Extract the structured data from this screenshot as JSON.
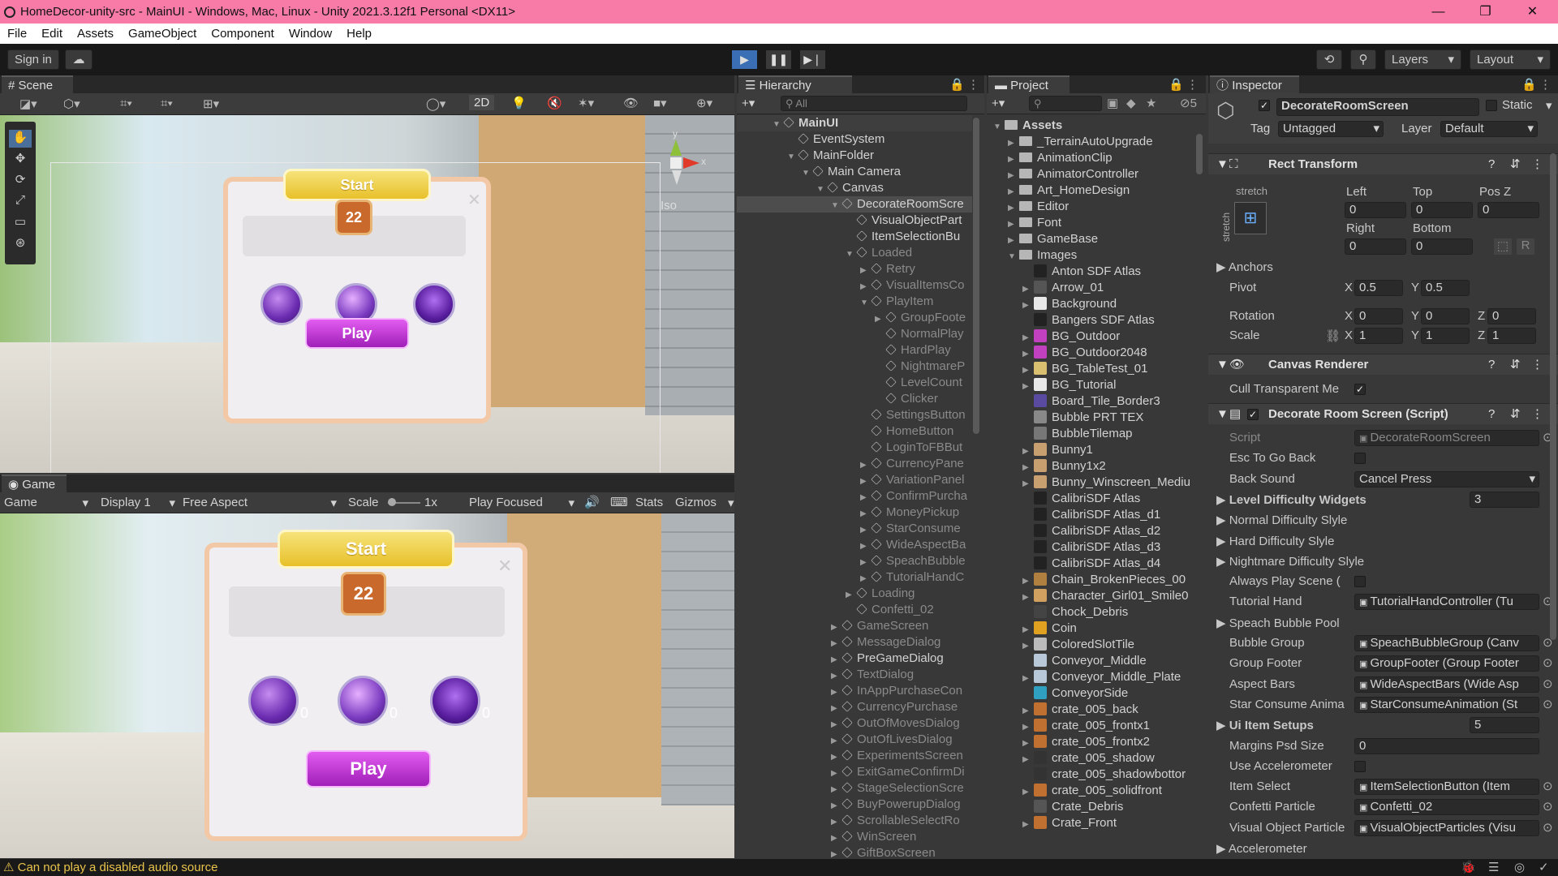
{
  "window": {
    "title": "HomeDecor-unity-src - MainUI - Windows, Mac, Linux - Unity 2021.3.12f1 Personal <DX11>",
    "minimize": "—",
    "restore": "❐",
    "close": "✕"
  },
  "menu": [
    "File",
    "Edit",
    "Assets",
    "GameObject",
    "Component",
    "Window",
    "Help"
  ],
  "toolbar": {
    "sign_in": "Sign in",
    "layers": "Layers",
    "layout": "Layout"
  },
  "scene": {
    "tab": "Scene",
    "mode_2d": "2D",
    "iso": "Iso",
    "gizmo_y": "y",
    "gizmo_x": "x",
    "start": "Start",
    "badge": "22",
    "play": "Play"
  },
  "game": {
    "tab": "Game",
    "dd_game": "Game",
    "display": "Display 1",
    "aspect": "Free Aspect",
    "scale_label": "Scale",
    "scale_val": "1x",
    "play_focused": "Play Focused",
    "stats": "Stats",
    "gizmos": "Gizmos",
    "start": "Start",
    "badge": "22",
    "play": "Play",
    "orb_zero": "0"
  },
  "hierarchy": {
    "tab": "Hierarchy",
    "search": "All",
    "rows": [
      {
        "t": "MainUI",
        "d": 0,
        "a": "▼",
        "k": "scene",
        "s": "n"
      },
      {
        "t": "EventSystem",
        "d": 1,
        "a": "",
        "k": "cube",
        "s": "n"
      },
      {
        "t": "MainFolder",
        "d": 1,
        "a": "▼",
        "k": "cube",
        "s": "n"
      },
      {
        "t": "Main Camera",
        "d": 2,
        "a": "▼",
        "k": "cube",
        "s": "n"
      },
      {
        "t": "Canvas",
        "d": 3,
        "a": "▼",
        "k": "cube",
        "s": "n"
      },
      {
        "t": "DecorateRoomScre",
        "d": 4,
        "a": "▼",
        "k": "cube",
        "s": "sel"
      },
      {
        "t": "VisualObjectPart",
        "d": 5,
        "a": "",
        "k": "cube",
        "s": "n"
      },
      {
        "t": "ItemSelectionBu",
        "d": 5,
        "a": "",
        "k": "cube",
        "s": "n"
      },
      {
        "t": "Loaded",
        "d": 5,
        "a": "▼",
        "k": "cube",
        "s": "dim"
      },
      {
        "t": "Retry",
        "d": 6,
        "a": "▶",
        "k": "cube",
        "s": "dim"
      },
      {
        "t": "VisualItemsCo",
        "d": 6,
        "a": "▶",
        "k": "cube",
        "s": "dim"
      },
      {
        "t": "PlayItem",
        "d": 6,
        "a": "▼",
        "k": "cube",
        "s": "dim"
      },
      {
        "t": "GroupFoote",
        "d": 7,
        "a": "▶",
        "k": "cube",
        "s": "dim"
      },
      {
        "t": "NormalPlay",
        "d": 7,
        "a": "",
        "k": "cube",
        "s": "dim"
      },
      {
        "t": "HardPlay",
        "d": 7,
        "a": "",
        "k": "cube",
        "s": "dim"
      },
      {
        "t": "NightmareP",
        "d": 7,
        "a": "",
        "k": "cube",
        "s": "dim"
      },
      {
        "t": "LevelCount",
        "d": 7,
        "a": "",
        "k": "cube",
        "s": "dim"
      },
      {
        "t": "Clicker",
        "d": 7,
        "a": "",
        "k": "cube",
        "s": "dim"
      },
      {
        "t": "SettingsButton",
        "d": 6,
        "a": "",
        "k": "cube",
        "s": "dim"
      },
      {
        "t": "HomeButton",
        "d": 6,
        "a": "",
        "k": "cube",
        "s": "dim"
      },
      {
        "t": "LoginToFBBut",
        "d": 6,
        "a": "",
        "k": "cube",
        "s": "dim"
      },
      {
        "t": "CurrencyPane",
        "d": 6,
        "a": "▶",
        "k": "cube",
        "s": "dim"
      },
      {
        "t": "VariationPanel",
        "d": 6,
        "a": "▶",
        "k": "cube",
        "s": "dim"
      },
      {
        "t": "ConfirmPurcha",
        "d": 6,
        "a": "▶",
        "k": "cube",
        "s": "dim"
      },
      {
        "t": "MoneyPickup",
        "d": 6,
        "a": "▶",
        "k": "cube",
        "s": "dim"
      },
      {
        "t": "StarConsume",
        "d": 6,
        "a": "▶",
        "k": "cube",
        "s": "dim"
      },
      {
        "t": "WideAspectBa",
        "d": 6,
        "a": "▶",
        "k": "cube",
        "s": "dim"
      },
      {
        "t": "SpeachBubble",
        "d": 6,
        "a": "▶",
        "k": "cube",
        "s": "dim"
      },
      {
        "t": "TutorialHandC",
        "d": 6,
        "a": "▶",
        "k": "cube",
        "s": "dim"
      },
      {
        "t": "Loading",
        "d": 5,
        "a": "▶",
        "k": "cube",
        "s": "dim"
      },
      {
        "t": "Confetti_02",
        "d": 5,
        "a": "",
        "k": "cube",
        "s": "dim"
      },
      {
        "t": "GameScreen",
        "d": 4,
        "a": "▶",
        "k": "cube",
        "s": "dim"
      },
      {
        "t": "MessageDialog",
        "d": 4,
        "a": "▶",
        "k": "cube",
        "s": "dim"
      },
      {
        "t": "PreGameDialog",
        "d": 4,
        "a": "▶",
        "k": "cube",
        "s": "n"
      },
      {
        "t": "TextDialog",
        "d": 4,
        "a": "▶",
        "k": "cube",
        "s": "dim"
      },
      {
        "t": "InAppPurchaseCon",
        "d": 4,
        "a": "▶",
        "k": "cube",
        "s": "dim"
      },
      {
        "t": "CurrencyPurchase",
        "d": 4,
        "a": "▶",
        "k": "cube",
        "s": "dim"
      },
      {
        "t": "OutOfMovesDialog",
        "d": 4,
        "a": "▶",
        "k": "cube",
        "s": "dim"
      },
      {
        "t": "OutOfLivesDialog",
        "d": 4,
        "a": "▶",
        "k": "cube",
        "s": "dim"
      },
      {
        "t": "ExperimentsScreen",
        "d": 4,
        "a": "▶",
        "k": "cube",
        "s": "dim"
      },
      {
        "t": "ExitGameConfirmDi",
        "d": 4,
        "a": "▶",
        "k": "cube",
        "s": "dim"
      },
      {
        "t": "StageSelectionScre",
        "d": 4,
        "a": "▶",
        "k": "cube",
        "s": "dim"
      },
      {
        "t": "BuyPowerupDialog",
        "d": 4,
        "a": "▶",
        "k": "cube",
        "s": "dim"
      },
      {
        "t": "ScrollableSelectRo",
        "d": 4,
        "a": "▶",
        "k": "cube",
        "s": "dim"
      },
      {
        "t": "WinScreen",
        "d": 4,
        "a": "▶",
        "k": "cube",
        "s": "dim"
      },
      {
        "t": "GiftBoxScreen",
        "d": 4,
        "a": "▶",
        "k": "cube",
        "s": "dim"
      }
    ]
  },
  "project": {
    "tab": "Project",
    "hidden_count": "5",
    "rows": [
      {
        "t": "Assets",
        "d": 0,
        "a": "▼",
        "k": "folder",
        "c": "#b6b6b6"
      },
      {
        "t": "_TerrainAutoUpgrade",
        "d": 1,
        "a": "▶",
        "k": "folder",
        "c": "#b6b6b6"
      },
      {
        "t": "AnimationClip",
        "d": 1,
        "a": "▶",
        "k": "folder",
        "c": "#b6b6b6"
      },
      {
        "t": "AnimatorController",
        "d": 1,
        "a": "▶",
        "k": "folder",
        "c": "#b6b6b6"
      },
      {
        "t": "Art_HomeDesign",
        "d": 1,
        "a": "▶",
        "k": "folder",
        "c": "#b6b6b6"
      },
      {
        "t": "Editor",
        "d": 1,
        "a": "▶",
        "k": "folder",
        "c": "#b6b6b6"
      },
      {
        "t": "Font",
        "d": 1,
        "a": "▶",
        "k": "folder",
        "c": "#b6b6b6"
      },
      {
        "t": "GameBase",
        "d": 1,
        "a": "▶",
        "k": "folder",
        "c": "#b6b6b6"
      },
      {
        "t": "Images",
        "d": 1,
        "a": "▼",
        "k": "folder",
        "c": "#b6b6b6"
      },
      {
        "t": "Anton SDF Atlas",
        "d": 2,
        "a": "",
        "k": "ico",
        "c": "#222"
      },
      {
        "t": "Arrow_01",
        "d": 2,
        "a": "▶",
        "k": "ico",
        "c": "#555"
      },
      {
        "t": "Background",
        "d": 2,
        "a": "▶",
        "k": "ico",
        "c": "#e8e8e8"
      },
      {
        "t": "Bangers SDF Atlas",
        "d": 2,
        "a": "",
        "k": "ico",
        "c": "#222"
      },
      {
        "t": "BG_Outdoor",
        "d": 2,
        "a": "▶",
        "k": "ico",
        "c": "#c040c0"
      },
      {
        "t": "BG_Outdoor2048",
        "d": 2,
        "a": "▶",
        "k": "ico",
        "c": "#c040c0"
      },
      {
        "t": "BG_TableTest_01",
        "d": 2,
        "a": "▶",
        "k": "ico",
        "c": "#d8c070"
      },
      {
        "t": "BG_Tutorial",
        "d": 2,
        "a": "▶",
        "k": "ico",
        "c": "#e8e8e8"
      },
      {
        "t": "Board_Tile_Border3",
        "d": 2,
        "a": "",
        "k": "ico",
        "c": "#5a4aa0"
      },
      {
        "t": "Bubble PRT TEX",
        "d": 2,
        "a": "",
        "k": "ico",
        "c": "#888"
      },
      {
        "t": "BubbleTilemap",
        "d": 2,
        "a": "",
        "k": "ico",
        "c": "#777"
      },
      {
        "t": "Bunny1",
        "d": 2,
        "a": "▶",
        "k": "ico",
        "c": "#c8a070"
      },
      {
        "t": "Bunny1x2",
        "d": 2,
        "a": "▶",
        "k": "ico",
        "c": "#c8a070"
      },
      {
        "t": "Bunny_Winscreen_Mediu",
        "d": 2,
        "a": "▶",
        "k": "ico",
        "c": "#c8a070"
      },
      {
        "t": "CalibriSDF Atlas",
        "d": 2,
        "a": "",
        "k": "ico",
        "c": "#222"
      },
      {
        "t": "CalibriSDF Atlas_d1",
        "d": 2,
        "a": "",
        "k": "ico",
        "c": "#222"
      },
      {
        "t": "CalibriSDF Atlas_d2",
        "d": 2,
        "a": "",
        "k": "ico",
        "c": "#222"
      },
      {
        "t": "CalibriSDF Atlas_d3",
        "d": 2,
        "a": "",
        "k": "ico",
        "c": "#222"
      },
      {
        "t": "CalibriSDF Atlas_d4",
        "d": 2,
        "a": "",
        "k": "ico",
        "c": "#222"
      },
      {
        "t": "Chain_BrokenPieces_00",
        "d": 2,
        "a": "▶",
        "k": "ico",
        "c": "#b08040"
      },
      {
        "t": "Character_Girl01_Smile0",
        "d": 2,
        "a": "▶",
        "k": "ico",
        "c": "#d0a060"
      },
      {
        "t": "Chock_Debris",
        "d": 2,
        "a": "",
        "k": "ico",
        "c": "#444"
      },
      {
        "t": "Coin",
        "d": 2,
        "a": "▶",
        "k": "ico",
        "c": "#e0a020"
      },
      {
        "t": "ColoredSlotTile",
        "d": 2,
        "a": "▶",
        "k": "ico",
        "c": "#bbb"
      },
      {
        "t": "Conveyor_Middle",
        "d": 2,
        "a": "",
        "k": "ico",
        "c": "#b8c8d8"
      },
      {
        "t": "Conveyor_Middle_Plate",
        "d": 2,
        "a": "▶",
        "k": "ico",
        "c": "#b8c8d8"
      },
      {
        "t": "ConveyorSide",
        "d": 2,
        "a": "",
        "k": "ico",
        "c": "#30a0c0"
      },
      {
        "t": "crate_005_back",
        "d": 2,
        "a": "▶",
        "k": "ico",
        "c": "#c07030"
      },
      {
        "t": "crate_005_frontx1",
        "d": 2,
        "a": "▶",
        "k": "ico",
        "c": "#c07030"
      },
      {
        "t": "crate_005_frontx2",
        "d": 2,
        "a": "▶",
        "k": "ico",
        "c": "#c07030"
      },
      {
        "t": "crate_005_shadow",
        "d": 2,
        "a": "▶",
        "k": "ico",
        "c": "#333"
      },
      {
        "t": "crate_005_shadowbottor",
        "d": 2,
        "a": "",
        "k": "ico",
        "c": "#333"
      },
      {
        "t": "crate_005_solidfront",
        "d": 2,
        "a": "▶",
        "k": "ico",
        "c": "#c07030"
      },
      {
        "t": "Crate_Debris",
        "d": 2,
        "a": "",
        "k": "ico",
        "c": "#555"
      },
      {
        "t": "Crate_Front",
        "d": 2,
        "a": "▶",
        "k": "ico",
        "c": "#c07030"
      }
    ]
  },
  "inspector": {
    "tab": "Inspector",
    "object_name": "DecorateRoomScreen",
    "static": "Static",
    "tag_label": "Tag",
    "tag": "Untagged",
    "layer_label": "Layer",
    "layer": "Default",
    "rect": {
      "title": "Rect Transform",
      "stretch": "stretch",
      "stretch_v": "stretch",
      "left_l": "Left",
      "top_l": "Top",
      "posz_l": "Pos Z",
      "left": "0",
      "top": "0",
      "posz": "0",
      "right_l": "Right",
      "bottom_l": "Bottom",
      "right": "0",
      "bottom": "0",
      "r": "R",
      "anchors": "Anchors",
      "pivot": "Pivot",
      "pivot_x": "0.5",
      "pivot_y": "0.5",
      "rotation": "Rotation",
      "rx": "0",
      "ry": "0",
      "rz": "0",
      "scale": "Scale",
      "sx": "1",
      "sy": "1",
      "sz": "1",
      "x": "X",
      "y": "Y",
      "z": "Z"
    },
    "canvas_renderer": {
      "title": "Canvas Renderer",
      "cull": "Cull Transparent Me"
    },
    "script": {
      "title": "Decorate Room Screen (Script)",
      "rows": [
        {
          "l": "Script",
          "v": "DecorateRoomScreen",
          "type": "ref",
          "dim": true
        },
        {
          "l": "Esc To Go Back",
          "v": "",
          "type": "chk"
        },
        {
          "l": "Back Sound",
          "v": "Cancel Press",
          "type": "dd"
        },
        {
          "l": "Level Difficulty Widgets",
          "v": "3",
          "type": "fold"
        },
        {
          "l": "Normal Difficulty Slyle",
          "v": "",
          "type": "foldonly"
        },
        {
          "l": "Hard Difficulty Slyle",
          "v": "",
          "type": "foldonly"
        },
        {
          "l": "Nightmare Difficulty Slyle",
          "v": "",
          "type": "foldonly"
        },
        {
          "l": "Always Play Scene (",
          "v": "",
          "type": "chk"
        },
        {
          "l": "Tutorial Hand",
          "v": "TutorialHandController (Tu",
          "type": "ref"
        },
        {
          "l": "Speach Bubble Pool",
          "v": "",
          "type": "foldonly"
        },
        {
          "l": "Bubble Group",
          "v": "SpeachBubbleGroup (Canv",
          "type": "ref"
        },
        {
          "l": "Group Footer",
          "v": "GroupFooter (Group Footer",
          "type": "ref"
        },
        {
          "l": "Aspect Bars",
          "v": "WideAspectBars (Wide Asp",
          "type": "ref"
        },
        {
          "l": "Star Consume Anima",
          "v": "StarConsumeAnimation (St",
          "type": "ref"
        },
        {
          "l": "Ui Item Setups",
          "v": "5",
          "type": "fold"
        },
        {
          "l": "Margins Psd Size",
          "v": "0",
          "type": "num"
        },
        {
          "l": "Use Accelerometer",
          "v": "",
          "type": "chk"
        },
        {
          "l": "Item Select",
          "v": "ItemSelectionButton (Item",
          "type": "ref"
        },
        {
          "l": "Confetti Particle",
          "v": "Confetti_02",
          "type": "ref"
        },
        {
          "l": "Visual Object Particle",
          "v": "VisualObjectParticles (Visu",
          "type": "ref"
        },
        {
          "l": "Accelerometer",
          "v": "",
          "type": "foldonly"
        }
      ]
    }
  },
  "status": {
    "message": "Can not play a disabled audio source"
  }
}
